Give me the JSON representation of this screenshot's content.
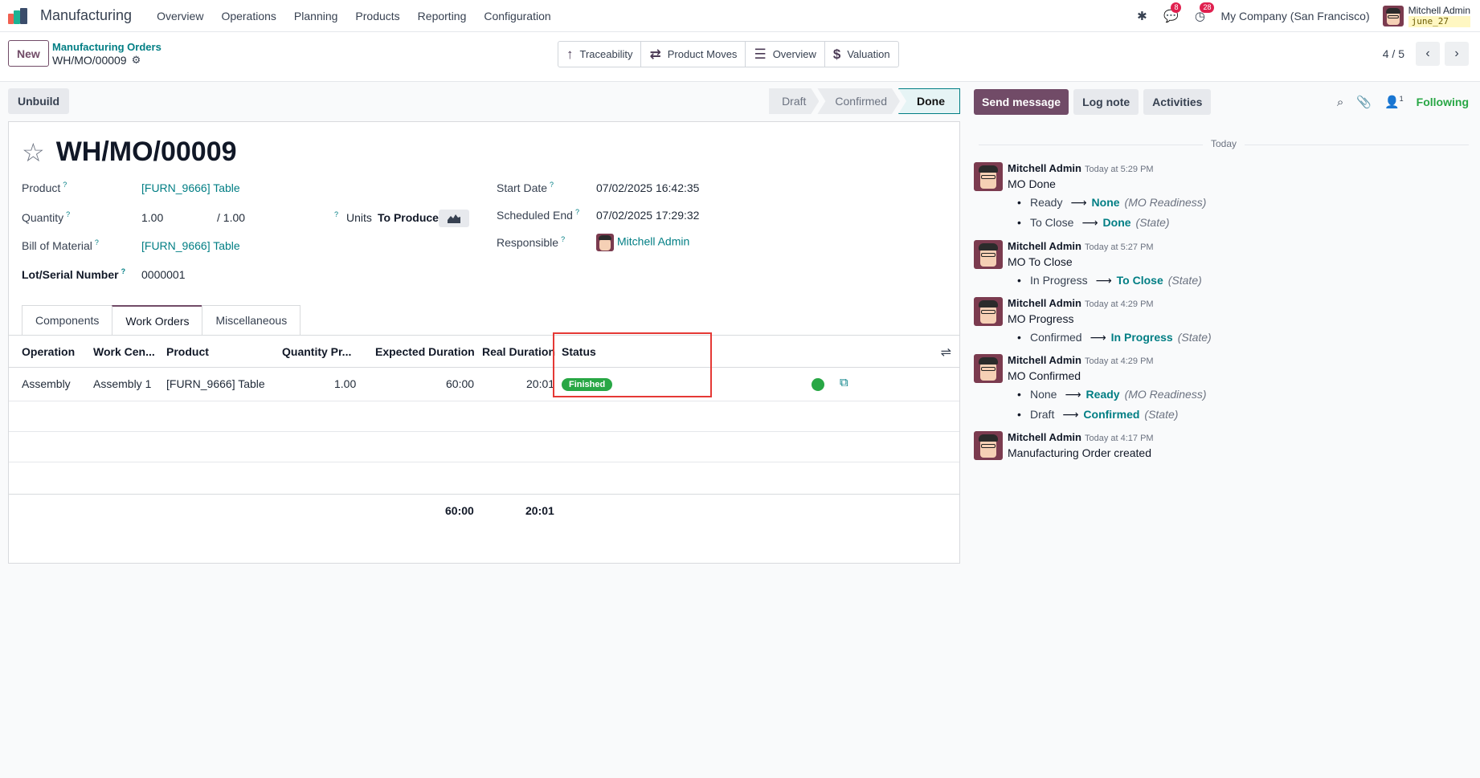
{
  "navbar": {
    "app_name": "Manufacturing",
    "menu": [
      "Overview",
      "Operations",
      "Planning",
      "Products",
      "Reporting",
      "Configuration"
    ],
    "messages_count": "8",
    "activities_count": "28",
    "company": "My Company (San Francisco)",
    "user_name": "Mitchell Admin",
    "database": "june_27"
  },
  "control": {
    "new_label": "New",
    "breadcrumb_parent": "Manufacturing Orders",
    "breadcrumb_current": "WH/MO/00009",
    "smart_buttons": [
      "Traceability",
      "Product Moves",
      "Overview",
      "Valuation"
    ],
    "pager": "4 / 5"
  },
  "statusbar": {
    "unbuild_label": "Unbuild",
    "stages": [
      "Draft",
      "Confirmed",
      "Done"
    ],
    "active_stage": "Done"
  },
  "form": {
    "title": "WH/MO/00009",
    "product_label": "Product",
    "product_value": "[FURN_9666] Table",
    "quantity_label": "Quantity",
    "quantity_value": "1.00",
    "quantity_total": "/ 1.00",
    "units_label": "Units",
    "to_produce_label": "To Produce",
    "bom_label": "Bill of Material",
    "bom_value": "[FURN_9666] Table",
    "lot_label": "Lot/Serial Number",
    "lot_value": "0000001",
    "start_date_label": "Start Date",
    "start_date_value": "07/02/2025 16:42:35",
    "scheduled_end_label": "Scheduled End",
    "scheduled_end_value": "07/02/2025 17:29:32",
    "responsible_label": "Responsible",
    "responsible_value": "Mitchell Admin",
    "help_mark": "?"
  },
  "tabs": [
    "Components",
    "Work Orders",
    "Miscellaneous"
  ],
  "table": {
    "headers": [
      "Operation",
      "Work Cen...",
      "Product",
      "Quantity Pr...",
      "Expected Duration",
      "Real Duration",
      "Status"
    ],
    "rows": [
      {
        "operation": "Assembly",
        "work_center": "Assembly 1",
        "product": "[FURN_9666] Table",
        "quantity": "1.00",
        "expected": "60:00",
        "real": "20:01",
        "status": "Finished"
      }
    ],
    "total_expected": "60:00",
    "total_real": "20:01"
  },
  "chatter": {
    "send_message": "Send message",
    "log_note": "Log note",
    "activities": "Activities",
    "followers_count": "1",
    "following": "Following",
    "today": "Today",
    "messages": [
      {
        "author": "Mitchell Admin",
        "time": "Today at 5:29 PM",
        "body": "MO Done",
        "tracking": [
          {
            "old": "Ready",
            "new": "None",
            "field": "(MO Readiness)"
          },
          {
            "old": "To Close",
            "new": "Done",
            "field": "(State)"
          }
        ]
      },
      {
        "author": "Mitchell Admin",
        "time": "Today at 5:27 PM",
        "body": "MO To Close",
        "tracking": [
          {
            "old": "In Progress",
            "new": "To Close",
            "field": "(State)"
          }
        ]
      },
      {
        "author": "Mitchell Admin",
        "time": "Today at 4:29 PM",
        "body": "MO Progress",
        "tracking": [
          {
            "old": "Confirmed",
            "new": "In Progress",
            "field": "(State)"
          }
        ]
      },
      {
        "author": "Mitchell Admin",
        "time": "Today at 4:29 PM",
        "body": "MO Confirmed",
        "tracking": [
          {
            "old": "None",
            "new": "Ready",
            "field": "(MO Readiness)"
          },
          {
            "old": "Draft",
            "new": "Confirmed",
            "field": "(State)"
          }
        ]
      },
      {
        "author": "Mitchell Admin",
        "time": "Today at 4:17 PM",
        "body": "Manufacturing Order created",
        "tracking": []
      }
    ]
  },
  "colors": {
    "brand": "#714b67",
    "link": "#017e84",
    "success": "#28a745",
    "highlight": "#e53935"
  }
}
